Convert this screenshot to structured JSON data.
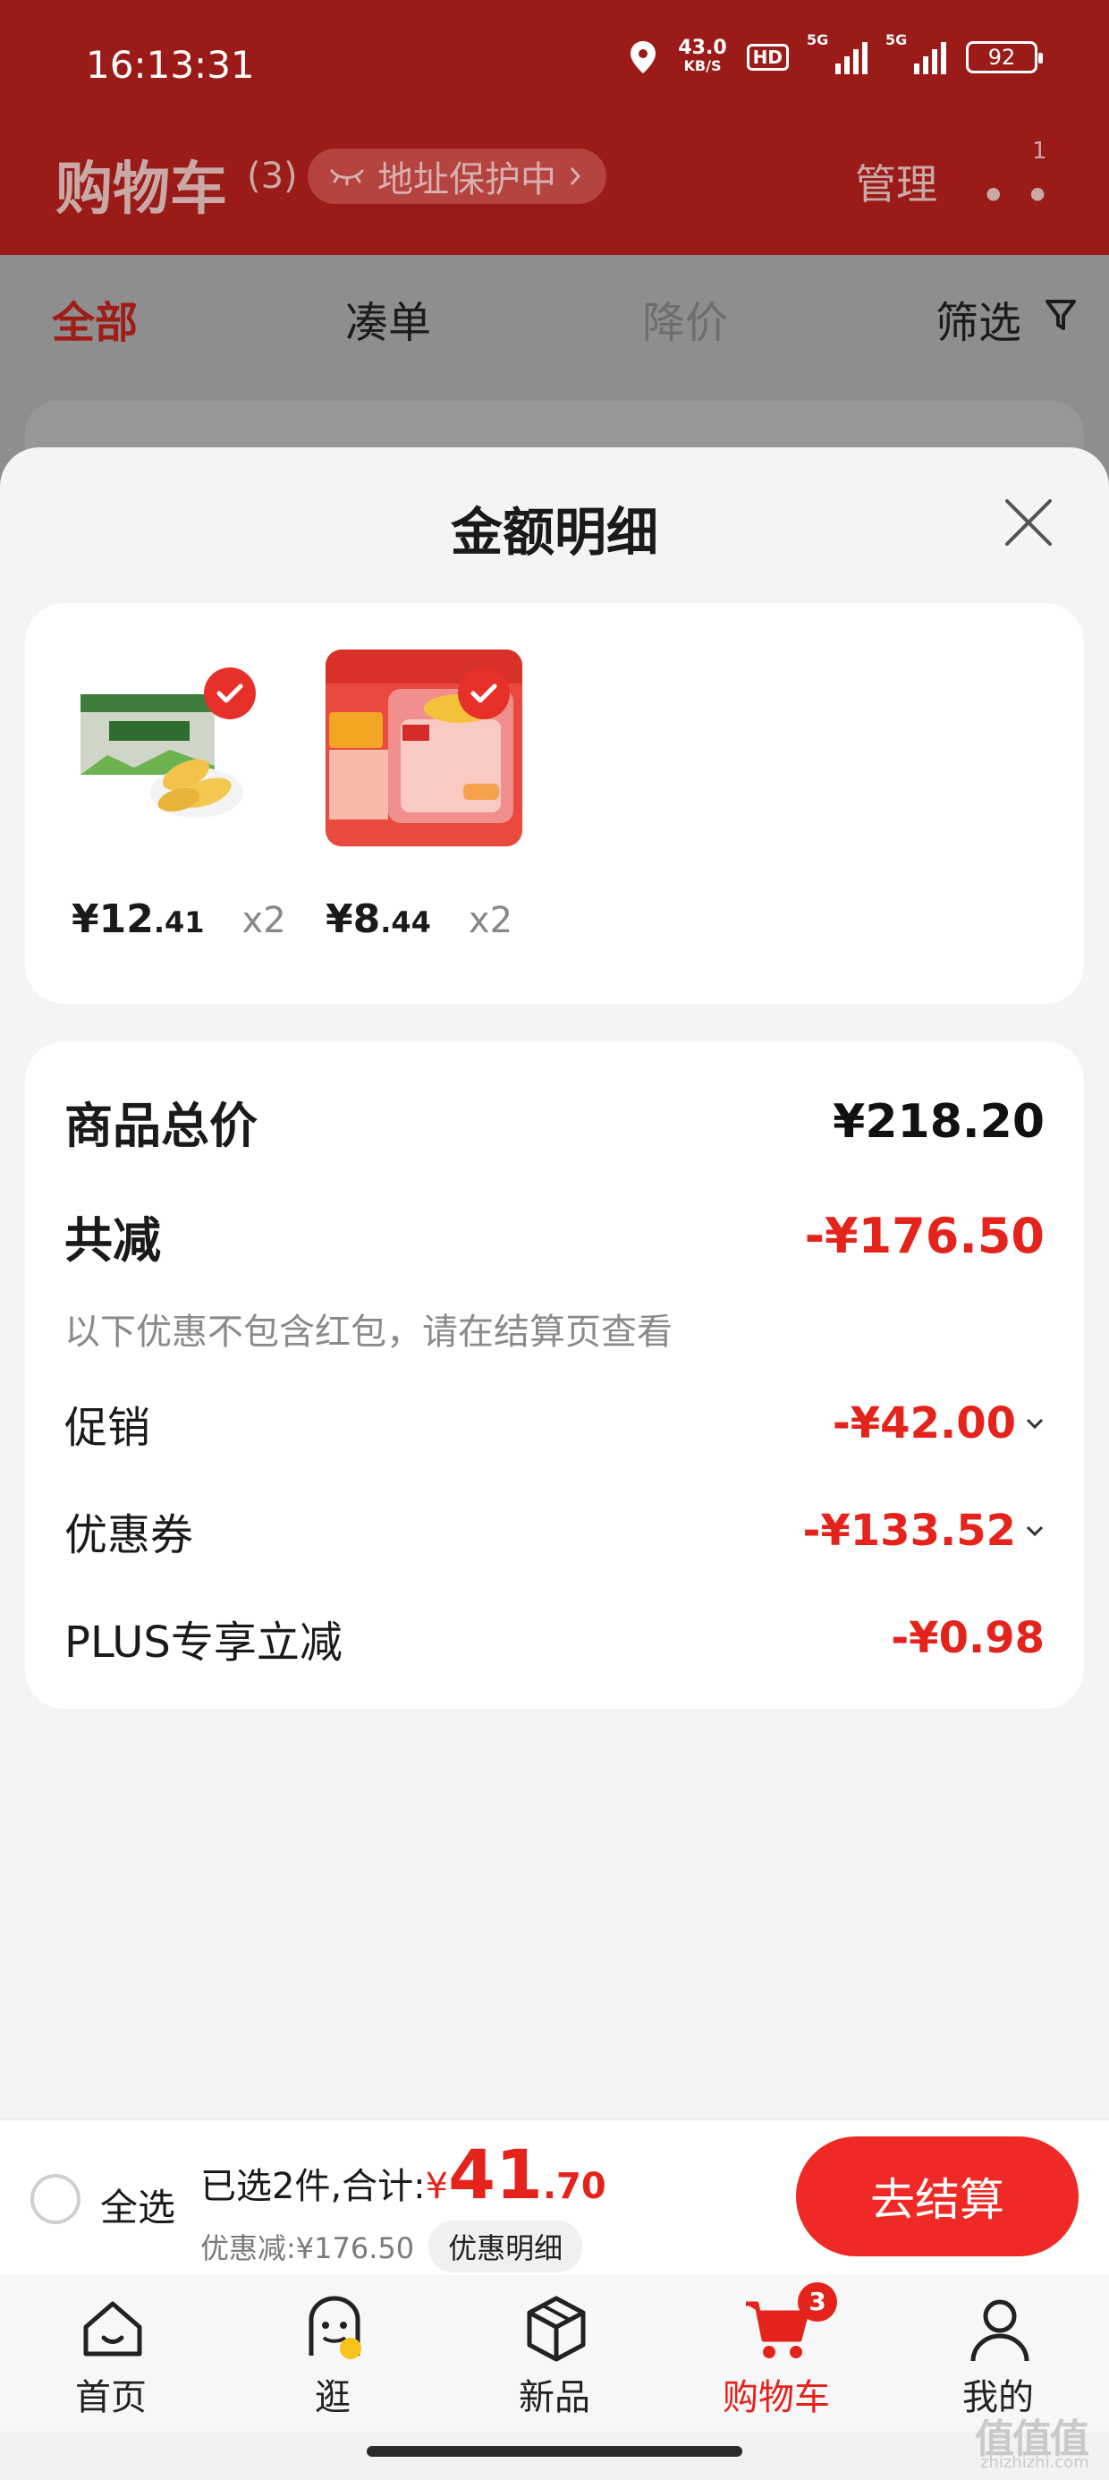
{
  "status_bar": {
    "time": "16:13:31",
    "net_speed": "43.0",
    "net_unit": "KB/S",
    "hd": "HD",
    "signal1": "5G",
    "signal2": "5G",
    "battery": "92"
  },
  "header": {
    "title": "购物车",
    "count": "(3)",
    "address": "地址保护中",
    "manage": "管理",
    "more_badge": "1"
  },
  "tabs": {
    "all": "全部",
    "bundle": "凑单",
    "price_drop": "降价",
    "filter": "筛选"
  },
  "sheet": {
    "title": "金额明细",
    "products": [
      {
        "price_int": "¥12",
        "price_dec": ".41",
        "qty": "x2"
      },
      {
        "price_int": "¥8",
        "price_dec": ".44",
        "qty": "x2"
      }
    ],
    "summary": {
      "total_label": "商品总价",
      "total_value": "¥218.20",
      "reduce_label": "共减",
      "reduce_value": "-¥176.50",
      "note": "以下优惠不包含红包，请在结算页查看",
      "promo_label": "促销",
      "promo_value": "-¥42.00",
      "coupon_label": "优惠券",
      "coupon_value": "-¥133.52",
      "plus_label": "PLUS专享立减",
      "plus_value": "-¥0.98"
    }
  },
  "checkout": {
    "select_all": "全选",
    "selected_text": "已选2件,合计:",
    "currency": "¥",
    "total_int": "41",
    "total_dec": ".70",
    "discount": "优惠减:¥176.50",
    "detail": "优惠明细",
    "pay": "去结算"
  },
  "nav": [
    {
      "label": "首页",
      "icon": "home-icon"
    },
    {
      "label": "逛",
      "icon": "browse-icon"
    },
    {
      "label": "新品",
      "icon": "cube-icon"
    },
    {
      "label": "购物车",
      "icon": "cart-icon",
      "badge": "3"
    },
    {
      "label": "我的",
      "icon": "profile-icon"
    }
  ],
  "watermark": {
    "main": "值值值",
    "sub": "zhizhizhi.com"
  },
  "colors": {
    "header_red": "#9a1b17",
    "accent_red": "#e4231c",
    "button_red": "#ef2a26"
  }
}
